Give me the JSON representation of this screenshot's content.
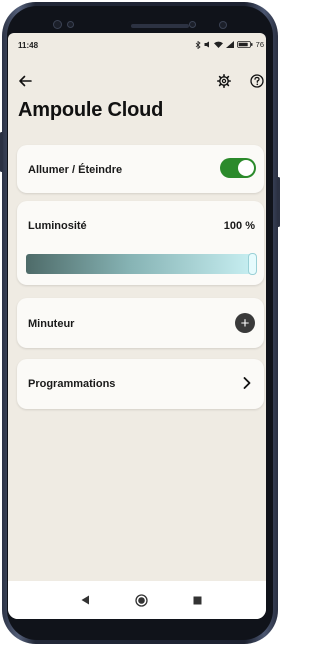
{
  "status_bar": {
    "time": "11:48",
    "battery": "76",
    "icons": [
      "bluetooth-icon",
      "mute-icon",
      "wifi-icon",
      "signal-icon",
      "battery-icon"
    ]
  },
  "header": {
    "title": "Ampoule Cloud",
    "back_icon": "arrow-left-icon",
    "settings_icon": "gear-icon",
    "help_icon": "question-circle-icon"
  },
  "power": {
    "label": "Allumer / Éteindre",
    "state": "on"
  },
  "brightness": {
    "label": "Luminosité",
    "value_text": "100 %",
    "level": 1.0
  },
  "timer": {
    "label": "Minuteur",
    "add_symbol": "+"
  },
  "schedules": {
    "label": "Programmations"
  },
  "colors": {
    "background": "#efebe3",
    "card": "#fbfaf7",
    "toggle_on": "#2b8a2b",
    "brightness_start": "#4e6b69",
    "brightness_end": "#c9f0f3"
  },
  "navbar": {
    "icons": [
      "back-triangle-icon",
      "home-circle-icon",
      "recents-square-icon"
    ]
  }
}
